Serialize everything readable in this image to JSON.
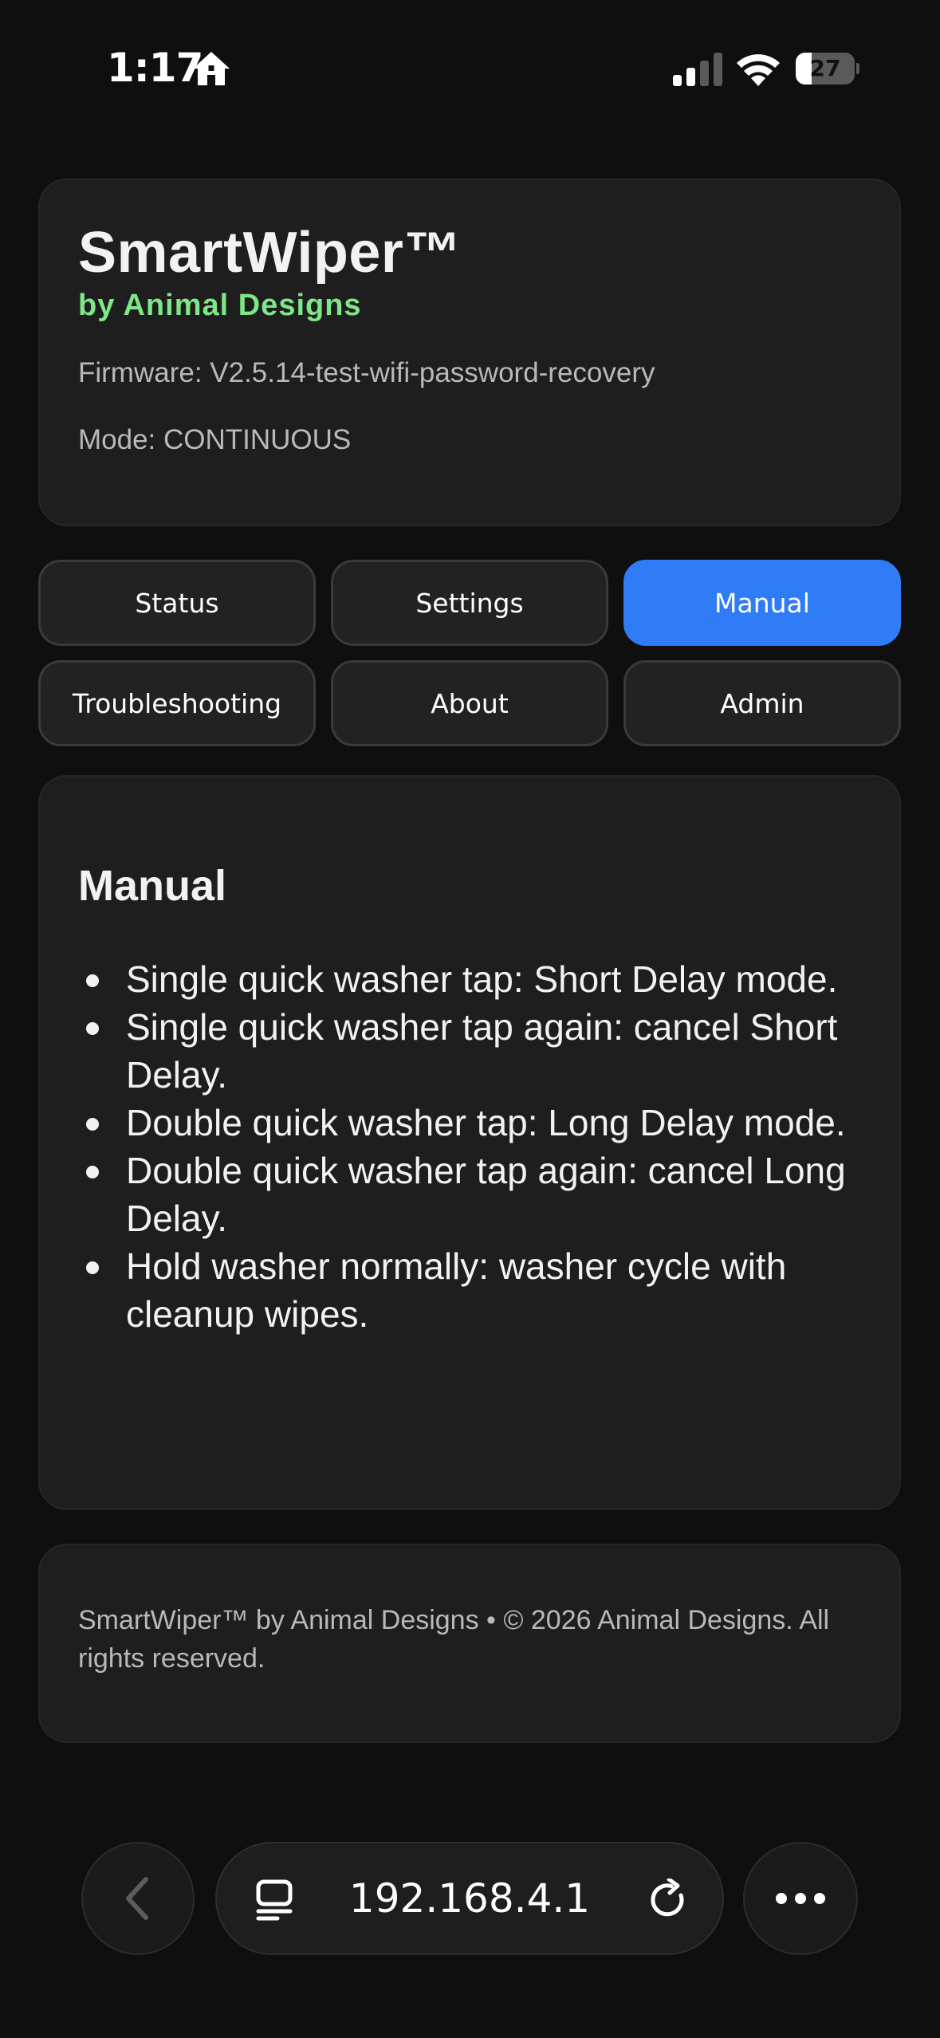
{
  "status_bar": {
    "time": "1:17",
    "battery_level": "27",
    "icons": [
      "home-icon",
      "cellular-signal-icon",
      "wifi-icon",
      "battery-icon"
    ]
  },
  "header": {
    "title": "SmartWiper™",
    "byline": "by Animal Designs",
    "firmware": "Firmware: V2.5.14-test-wifi-password-recovery",
    "mode": "Mode: CONTINUOUS"
  },
  "tabs": [
    {
      "label": "Status",
      "active": false
    },
    {
      "label": "Settings",
      "active": false
    },
    {
      "label": "Manual",
      "active": true
    },
    {
      "label": "Troubleshooting",
      "active": false
    },
    {
      "label": "About",
      "active": false
    },
    {
      "label": "Admin",
      "active": false
    }
  ],
  "manual": {
    "title": "Manual",
    "items": [
      "Single quick washer tap: Short Delay mode.",
      "Single quick washer tap again: cancel Short Delay.",
      "Double quick washer tap: Long Delay mode.",
      "Double quick washer tap again: cancel Long Delay.",
      "Hold washer normally: washer cycle with cleanup wipes."
    ]
  },
  "footer": {
    "text": "SmartWiper™ by Animal Designs • © 2026 Animal Designs. All rights reserved."
  },
  "browser": {
    "url": "192.168.4.1",
    "icons": [
      "back-chevron-icon",
      "tabs-icon",
      "reload-icon",
      "more-icon"
    ]
  },
  "colors": {
    "background": "#0f0f0f",
    "card": "#1e1e1e",
    "accent_blue": "#2f7cf6",
    "byline_green": "#7ee787"
  }
}
